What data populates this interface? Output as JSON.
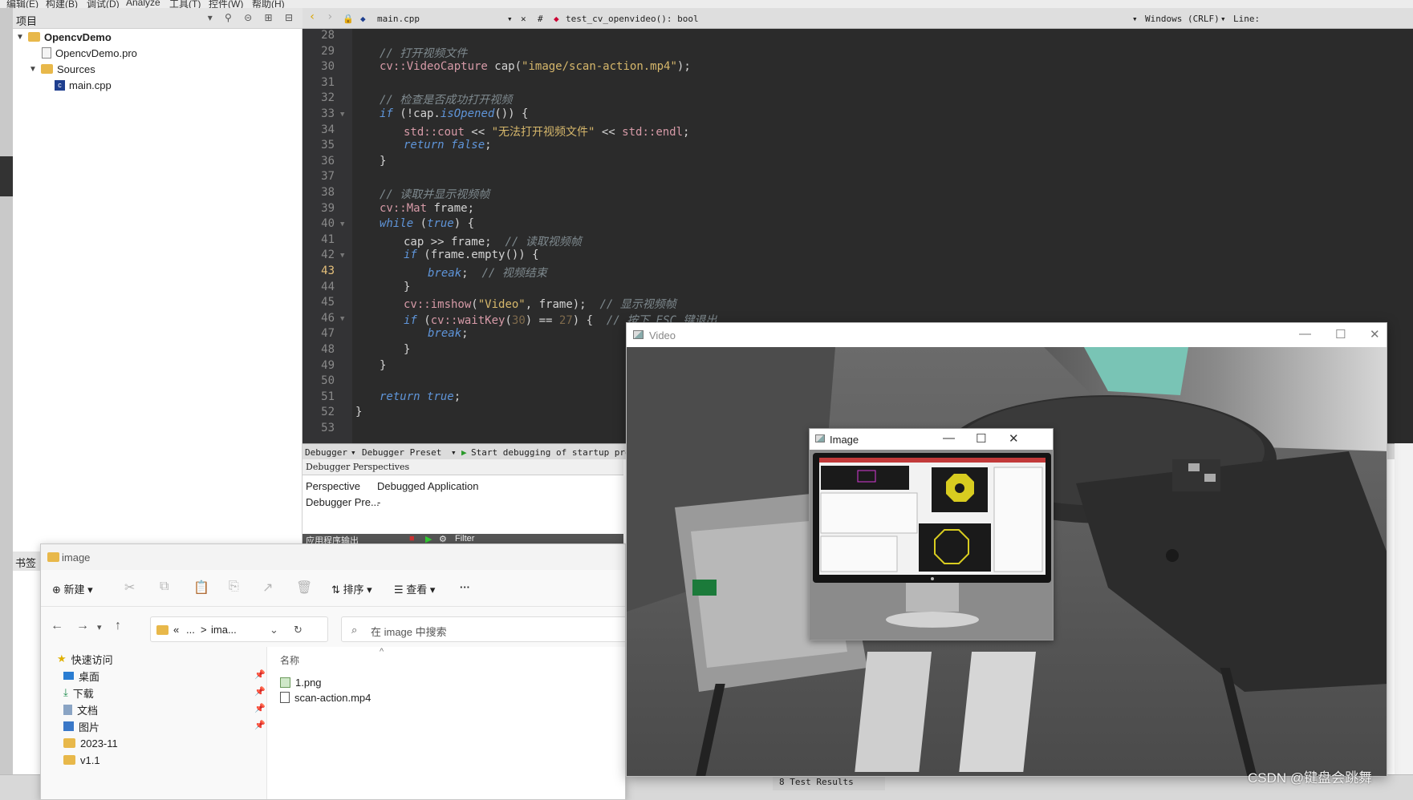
{
  "menubar": {
    "items": [
      "编辑(E)",
      "构建(B)",
      "调试(D)",
      "Analyze",
      "工具(T)",
      "控件(W)",
      "帮助(H)"
    ]
  },
  "project_panel": {
    "title": "项目",
    "tree": [
      {
        "label": "OpencvDemo",
        "kind": "project"
      },
      {
        "label": "OpencvDemo.pro",
        "kind": "pro-file"
      },
      {
        "label": "Sources",
        "kind": "folder"
      },
      {
        "label": "main.cpp",
        "kind": "cpp-file"
      }
    ]
  },
  "bookmarks": {
    "title": "书签"
  },
  "editor": {
    "file_tab": "main.cpp",
    "hash": "#",
    "function": "test_cv_openvideo(): bool",
    "line_ending": "Windows (CRLF)",
    "line_label": "Line:",
    "current_line": 43,
    "lines": [
      {
        "n": "28"
      },
      {
        "n": "29"
      },
      {
        "n": "30"
      },
      {
        "n": "31"
      },
      {
        "n": "32"
      },
      {
        "n": "33"
      },
      {
        "n": "34"
      },
      {
        "n": "35"
      },
      {
        "n": "36"
      },
      {
        "n": "37"
      },
      {
        "n": "38"
      },
      {
        "n": "39"
      },
      {
        "n": "40"
      },
      {
        "n": "41"
      },
      {
        "n": "42"
      },
      {
        "n": "43"
      },
      {
        "n": "44"
      },
      {
        "n": "45"
      },
      {
        "n": "46"
      },
      {
        "n": "47"
      },
      {
        "n": "48"
      },
      {
        "n": "49"
      },
      {
        "n": "50"
      },
      {
        "n": "51"
      },
      {
        "n": "52"
      },
      {
        "n": "53"
      }
    ],
    "code": {
      "c29": "// 打开视频文件",
      "c30a": "cv::",
      "c30b": "VideoCapture",
      "c30c": " cap(",
      "c30d": "\"image/scan-action.mp4\"",
      "c30e": ");",
      "c32": "// 检查是否成功打开视频",
      "c33a": "if",
      "c33b": " (!cap.",
      "c33c": "isOpened",
      "c33d": "()) {",
      "c34a": "std::",
      "c34b": "cout",
      "c34c": " << ",
      "c34d": "\"无法打开视频文件\"",
      "c34e": " << ",
      "c34f": "std::",
      "c34g": "endl",
      "c34h": ";",
      "c35a": "return",
      "c35b": " ",
      "c35c": "false",
      "c35d": ";",
      "c36": "}",
      "c38": "// 读取并显示视频帧",
      "c39a": "cv::",
      "c39b": "Mat",
      "c39c": " frame;",
      "c40a": "while",
      "c40b": " (",
      "c40c": "true",
      "c40d": ") {",
      "c41a": "cap >> frame;  ",
      "c41b": "// 读取视频帧",
      "c42a": "if",
      "c42b": " (frame.",
      "c42c": "empty",
      "c42d": "()) {",
      "c43a": "break",
      "c43b": ";  ",
      "c43c": "// 视频结束",
      "c44": "}",
      "c45a": "cv::",
      "c45b": "imshow",
      "c45c": "(",
      "c45d": "\"Video\"",
      "c45e": ", frame);  ",
      "c45f": "// 显示视频帧",
      "c46a": "if",
      "c46b": " (",
      "c46c": "cv::",
      "c46d": "waitKey",
      "c46e": "(",
      "c46f": "30",
      "c46g": ") == ",
      "c46h": "27",
      "c46i": ") {  ",
      "c46j": "// 按下 ESC 键退出",
      "c47a": "break",
      "c47b": ";",
      "c48": "}",
      "c49": "}",
      "c51a": "return",
      "c51b": " ",
      "c51c": "true",
      "c51d": ";",
      "c52": "}"
    }
  },
  "debugger": {
    "combo1": "Debugger",
    "combo2": "Debugger Preset",
    "start": "Start debugging of startup pro",
    "perspectives_title": "Debugger Perspectives",
    "row1_label": "Perspective",
    "row1_value": "Debugged Application",
    "row2_label": "Debugger Pre...",
    "row2_value": "-",
    "output_tab": "应用程序输出",
    "filter": "Filter"
  },
  "test_results": "8 Test Results",
  "explorer": {
    "title": "image",
    "toolbar": {
      "new": "新建",
      "sort": "排序",
      "view": "查看",
      "more": "···"
    },
    "address": {
      "prefix": "«",
      "ellipsis": "...",
      "sep": ">",
      "current": "ima..."
    },
    "search_placeholder": "在 image 中搜索",
    "nav": [
      {
        "label": "快速访问",
        "icon": "star-icon"
      },
      {
        "label": "桌面",
        "icon": "desktop-icon"
      },
      {
        "label": "下载",
        "icon": "download-icon"
      },
      {
        "label": "文档",
        "icon": "document-icon"
      },
      {
        "label": "图片",
        "icon": "picture-icon"
      },
      {
        "label": "2023-11",
        "icon": "folder-icon"
      },
      {
        "label": "v1.1",
        "icon": "folder-icon"
      }
    ],
    "column_header": "名称",
    "files": [
      {
        "name": "1.png",
        "icon": "image-file-icon"
      },
      {
        "name": "scan-action.mp4",
        "icon": "video-file-icon"
      }
    ]
  },
  "video_window": {
    "title": "Video"
  },
  "image_window": {
    "title": "Image"
  },
  "watermark": "CSDN @键盘会跳舞",
  "colors": {
    "editor_bg": "#2b2b2b",
    "comment": "#7f8a8f",
    "keyword": "#5f95d9",
    "string": "#d6b76b",
    "namespace": "#d69aa7"
  }
}
